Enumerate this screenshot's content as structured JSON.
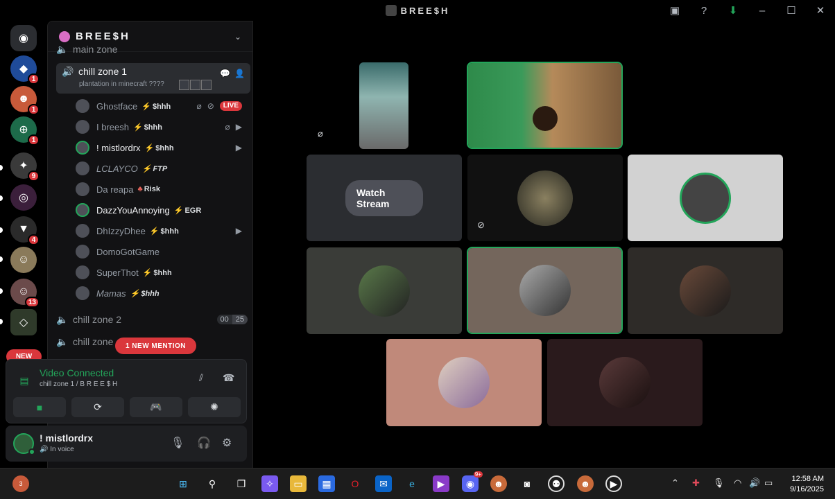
{
  "window": {
    "title": "BREE$H",
    "title_icons": [
      "inbox-icon",
      "help-icon",
      "download-icon",
      "minimize-icon",
      "maximize-icon",
      "close-icon"
    ]
  },
  "guilds": {
    "new_label": "NEW",
    "badges": [
      "1",
      "1",
      "1",
      "9",
      "4",
      "13"
    ]
  },
  "server": {
    "name": "BREE$H",
    "partial_channel": "main zone"
  },
  "channels": {
    "active": {
      "name": "chill zone 1",
      "activity": "plantation in minecraft ????"
    },
    "members": [
      {
        "name": "Ghostface",
        "tag": "$hhh",
        "live": "LIVE"
      },
      {
        "name": "I breesh",
        "tag": "$hhh"
      },
      {
        "name": "! mistlordrx",
        "tag": "$hhh"
      },
      {
        "name": "LCLAYCO",
        "tag": "FTP"
      },
      {
        "name": "Da reapa",
        "tag": "Risk"
      },
      {
        "name": "DazzYouAnnoying",
        "tag": "EGR"
      },
      {
        "name": "DhIzzyDhee",
        "tag": "$hhh"
      },
      {
        "name": "DomoGotGame",
        "tag": ""
      },
      {
        "name": "SuperThot",
        "tag": "$hhh"
      },
      {
        "name": "Mamas",
        "tag": "$hhh"
      }
    ],
    "zone2": {
      "name": "chill zone 2",
      "count_a": "00",
      "count_b": "25"
    },
    "zone3": {
      "name": "chill zone"
    },
    "mention_label": "1 NEW MENTION"
  },
  "voice_panel": {
    "status": "Video Connected",
    "channel": "chill zone 1 / B R E E $ H"
  },
  "user_bar": {
    "name": "! mistlordrx",
    "status": "In voice"
  },
  "stage": {
    "watch_stream_label": "Watch Stream"
  },
  "taskbar": {
    "notification_badge": "3",
    "discord_badge": "9+",
    "time": "12:58 AM",
    "date": "9/16/2025"
  },
  "colors": {
    "accent_green": "#23a55a",
    "danger_red": "#da373c",
    "blurple": "#5865f2"
  }
}
